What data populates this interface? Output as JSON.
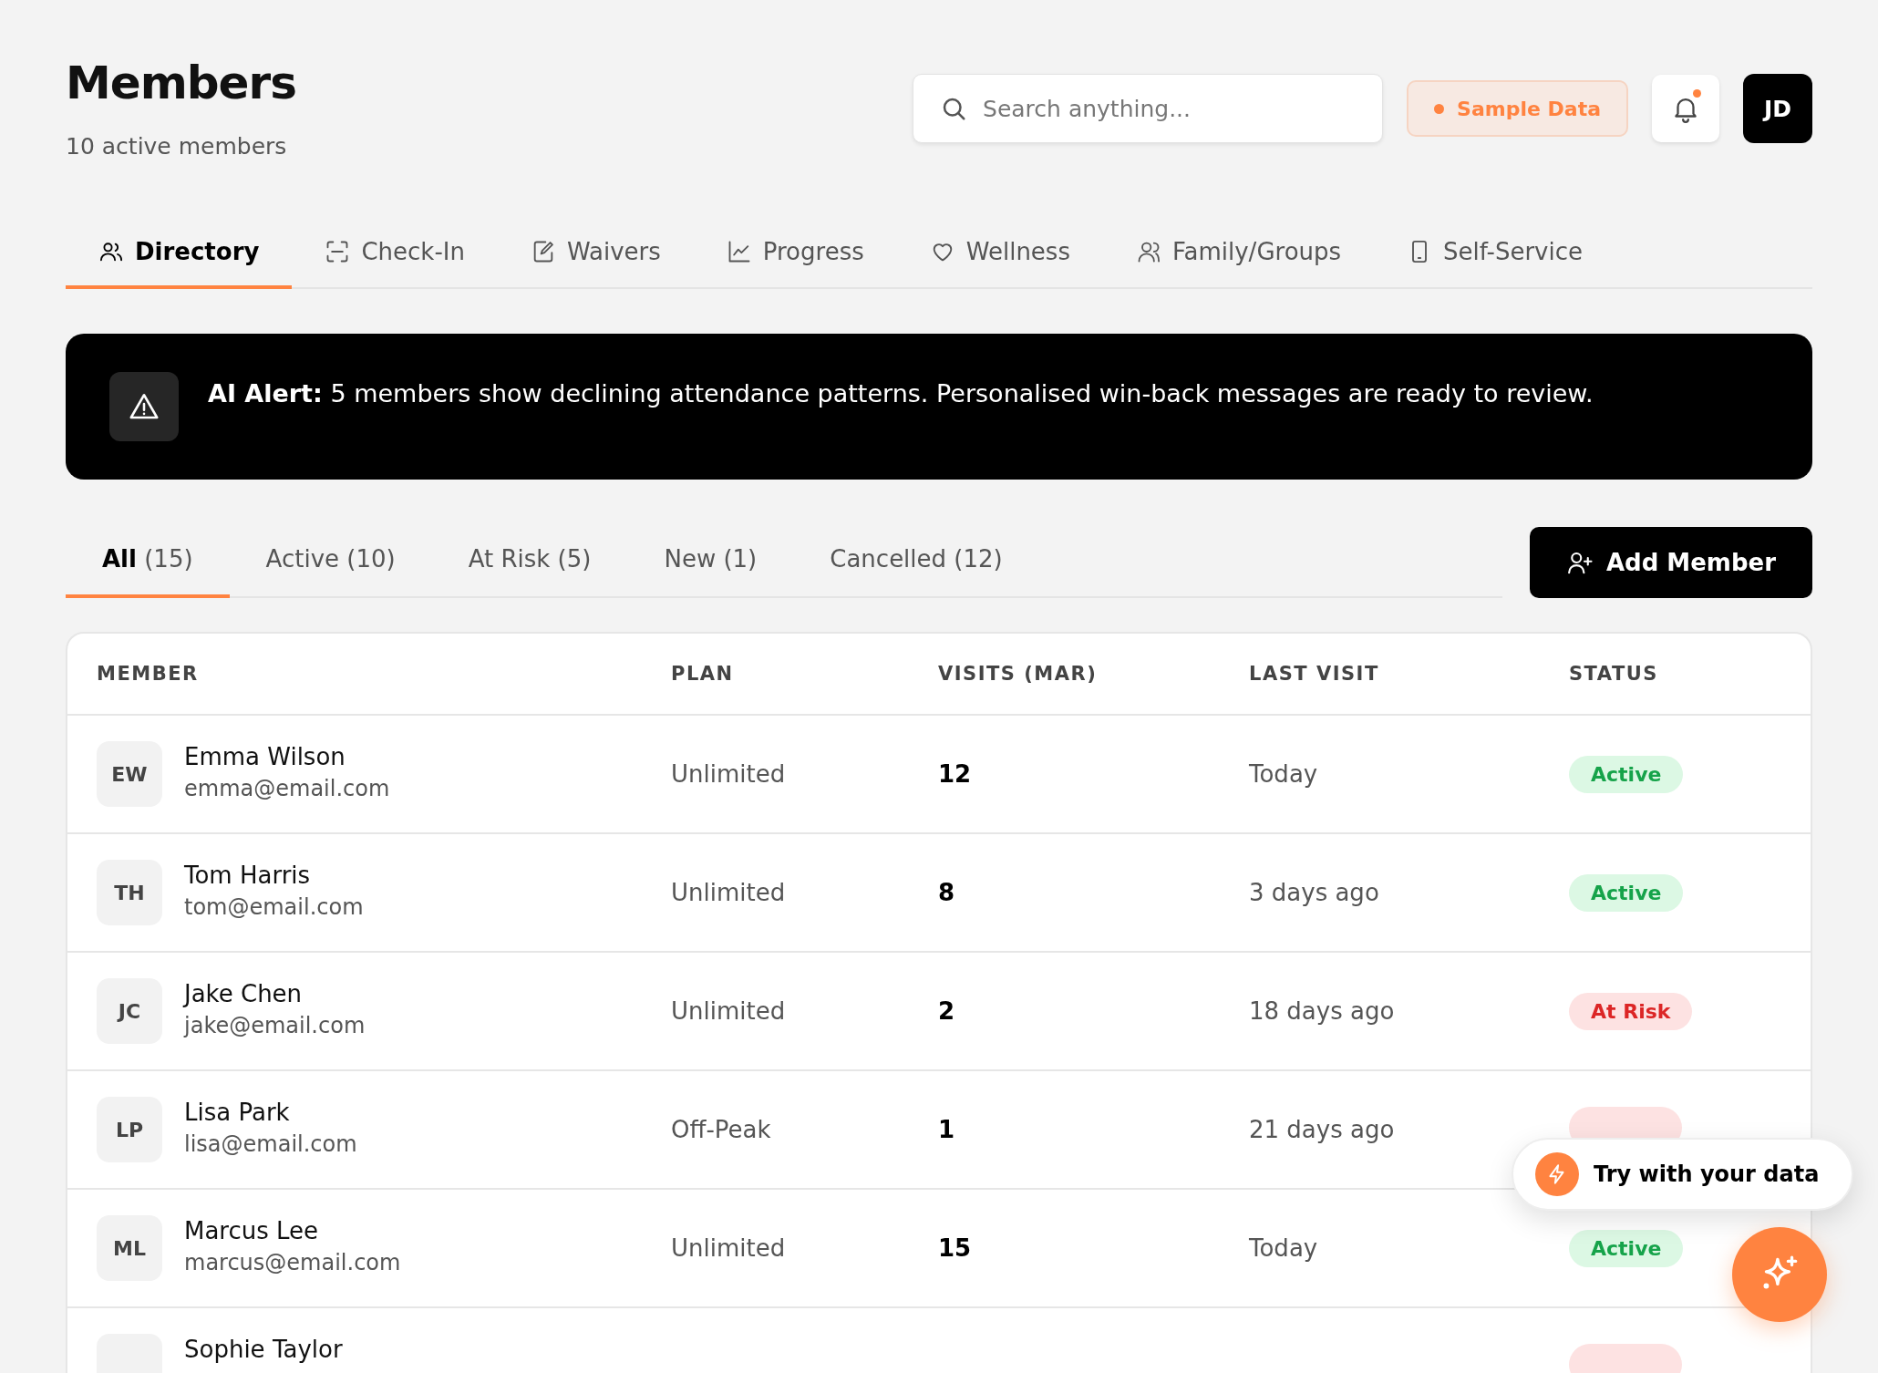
{
  "header": {
    "title": "Members",
    "subtitle": "10 active members",
    "search": {
      "placeholder": "Search anything..."
    },
    "sample_badge": "Sample Data",
    "notifications": {
      "unread": true
    },
    "avatar": "JD"
  },
  "tabs": [
    {
      "label": "Directory",
      "selected": true
    },
    {
      "label": "Check-In",
      "selected": false
    },
    {
      "label": "Waivers",
      "selected": false
    },
    {
      "label": "Progress",
      "selected": false
    },
    {
      "label": "Wellness",
      "selected": false
    },
    {
      "label": "Family/Groups",
      "selected": false
    },
    {
      "label": "Self-Service",
      "selected": false
    }
  ],
  "alert": {
    "text": "**AI Alert:** 5 members show declining attendance patterns. Personalised win-back messages are ready to review."
  },
  "filters": [
    {
      "label": "All",
      "count": "(15)",
      "selected": true
    },
    {
      "label": "Active",
      "count": "(10)",
      "selected": false
    },
    {
      "label": "At Risk",
      "count": "(5)",
      "selected": false
    },
    {
      "label": "New",
      "count": "(1)",
      "selected": false
    },
    {
      "label": "Cancelled",
      "count": "(12)",
      "selected": false
    }
  ],
  "add_button": "Add Member",
  "table": {
    "columns": [
      "MEMBER",
      "PLAN",
      "VISITS (MAR)",
      "LAST VISIT",
      "STATUS"
    ],
    "rows": [
      {
        "initials": "EW",
        "name": "Emma Wilson",
        "email": "emma@email.com",
        "plan": "Unlimited",
        "visits": "12",
        "last_visit": "Today",
        "status": {
          "kind": "active",
          "label": "Active"
        }
      },
      {
        "initials": "TH",
        "name": "Tom Harris",
        "email": "tom@email.com",
        "plan": "Unlimited",
        "visits": "8",
        "last_visit": "3 days ago",
        "status": {
          "kind": "active",
          "label": "Active"
        }
      },
      {
        "initials": "JC",
        "name": "Jake Chen",
        "email": "jake@email.com",
        "plan": "Unlimited",
        "visits": "2",
        "last_visit": "18 days ago",
        "status": {
          "kind": "at_risk",
          "label": "At Risk"
        }
      },
      {
        "initials": "LP",
        "name": "Lisa Park",
        "email": "lisa@email.com",
        "plan": "Off-Peak",
        "visits": "1",
        "last_visit": "21 days ago",
        "status": {
          "kind": "at_risk"
        }
      },
      {
        "initials": "ML",
        "name": "Marcus Lee",
        "email": "marcus@email.com",
        "plan": "Unlimited",
        "visits": "15",
        "last_visit": "Today",
        "status": {
          "kind": "active",
          "label": "Active"
        }
      },
      {
        "name": "Sophie Taylor",
        "status": {
          "kind": "at_risk"
        }
      }
    ]
  },
  "try_popup": "Try with your data"
}
